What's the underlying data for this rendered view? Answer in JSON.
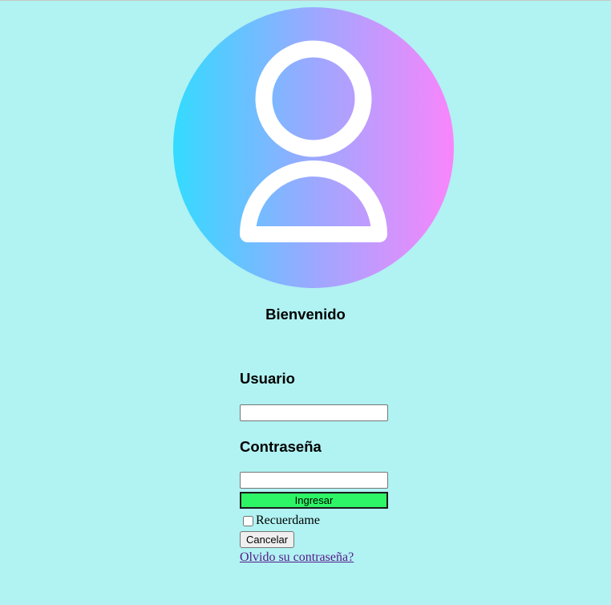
{
  "avatar": {
    "icon": "user-icon",
    "gradient": [
      "#33dbff",
      "#9ca8ff",
      "#f985fb"
    ]
  },
  "welcome_text": "Bienvenido",
  "form": {
    "username_label": "Usuario",
    "username_value": "",
    "password_label": "Contraseña",
    "password_value": "",
    "submit_label": "Ingresar",
    "remember_label": "Recuerdame",
    "remember_checked": false,
    "cancel_label": "Cancelar",
    "forgot_link": "Olvido su contraseña?"
  },
  "colors": {
    "background": "#b1f2f2",
    "submit_button": "#2ef566",
    "link": "#551a8b"
  }
}
